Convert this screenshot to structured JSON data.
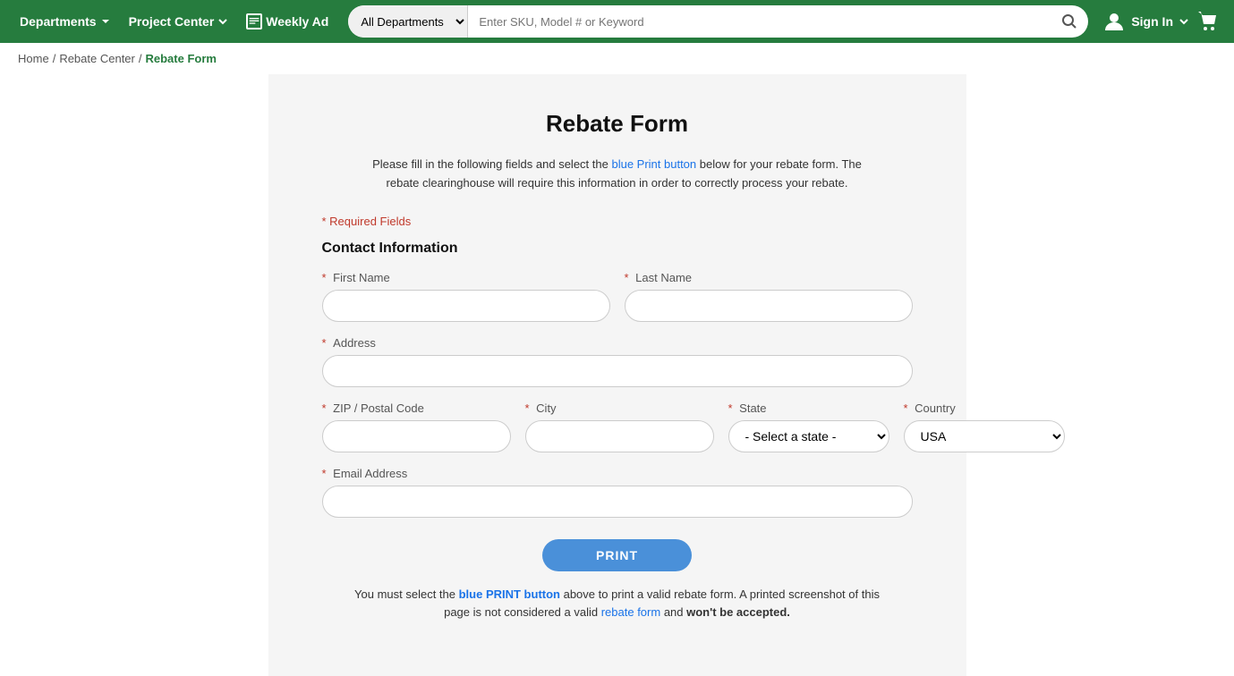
{
  "header": {
    "bg_color": "#267c3e",
    "departments_label": "Departments",
    "project_center_label": "Project Center",
    "weekly_ad_label": "Weekly Ad",
    "search_placeholder": "Enter SKU, Model # or Keyword",
    "dept_select_default": "All Departments",
    "sign_in_label": "Sign In"
  },
  "breadcrumb": {
    "home": "Home",
    "rebate_center": "Rebate Center",
    "current": "Rebate Form",
    "sep1": "/",
    "sep2": "/"
  },
  "form": {
    "title": "Rebate Form",
    "description_part1": "Please fill in the following fields and select the blue Print button below for your rebate form. The rebate clearinghouse will require this information in order to correctly process your rebate.",
    "required_note": "* Required Fields",
    "section_title": "Contact Information",
    "first_name_label": "First Name",
    "last_name_label": "Last Name",
    "address_label": "Address",
    "zip_label": "ZIP / Postal Code",
    "city_label": "City",
    "state_label": "State",
    "country_label": "Country",
    "email_label": "Email Address",
    "state_placeholder": "- Select a state -",
    "country_default": "USA",
    "print_btn": "PRINT",
    "print_notice": "You must select the blue PRINT button above to print a valid rebate form. A printed screenshot of this page is not considered a valid rebate form and won't be accepted."
  }
}
